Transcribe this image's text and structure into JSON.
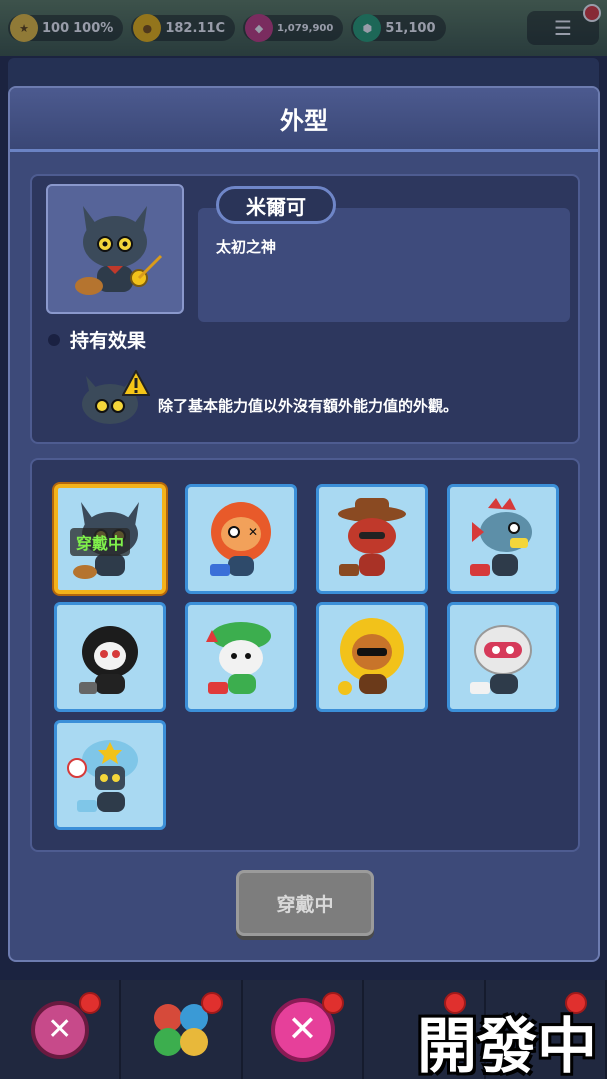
{
  "topbar": {
    "level": "100",
    "exp": "100%",
    "coins": "182.11C",
    "gems": "1,079,900",
    "crystals": "51,100"
  },
  "dialog": {
    "title": "外型",
    "character_name": "米爾可",
    "character_desc": "太初之神",
    "effect_heading": "持有效果",
    "effect_text": "除了基本能力值以外沒有額外能力值的外觀。"
  },
  "skins": [
    {
      "name": "default-cat",
      "color": "#34495e",
      "equipped": true,
      "equipped_label": "穿戴中"
    },
    {
      "name": "lion",
      "color": "#e85a2a"
    },
    {
      "name": "cowboy",
      "color": "#c0392b"
    },
    {
      "name": "shark",
      "color": "#5d8fa8"
    },
    {
      "name": "reaper",
      "color": "#222222"
    },
    {
      "name": "dino",
      "color": "#3cae4e"
    },
    {
      "name": "sunflower",
      "color": "#f2c21a"
    },
    {
      "name": "astronaut",
      "color": "#e8e8e8"
    },
    {
      "name": "police",
      "color": "#7fc6e8"
    }
  ],
  "buttons": {
    "equip": "穿戴中"
  },
  "overlay": {
    "dev_label": "開發中"
  },
  "colors": {
    "accent": "#f3b21a",
    "panel": "#3d4a79",
    "skin_bg": "#a9d9f2",
    "close": "#e6409a"
  }
}
